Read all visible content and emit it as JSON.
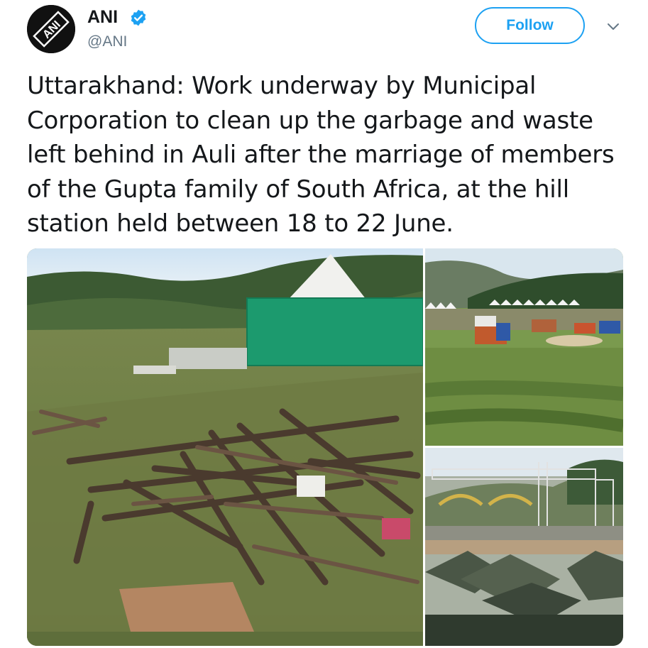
{
  "account": {
    "display_name": "ANI",
    "handle": "@ANI",
    "avatar_icon": "ani-logo-icon",
    "verified_icon": "verified-badge-icon",
    "accent_color": "#1da1f2"
  },
  "actions": {
    "follow_label": "Follow",
    "more_icon": "chevron-down-icon"
  },
  "tweet": {
    "text": "Uttarakhand: Work underway by Municipal Corporation to clean up the garbage and waste left behind in Auli after the marriage of members of the Gupta family of South Africa, at the hill station held between 18 to 22 June."
  },
  "media": {
    "photos": [
      {
        "subject": "pile of scaffolding pipes and waste on hillside"
      },
      {
        "subject": "trucks and tents on meadow"
      },
      {
        "subject": "dismantled stage truss and tents"
      }
    ]
  }
}
